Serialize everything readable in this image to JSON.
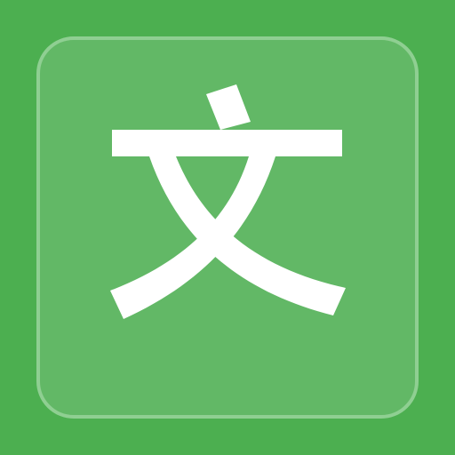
{
  "icon": {
    "glyph": "文",
    "name": "chinese-character-wen-icon",
    "colors": {
      "background": "#4caf50",
      "tile": "#62b866",
      "tile_border": "#8fcf92",
      "glyph": "#ffffff"
    }
  }
}
